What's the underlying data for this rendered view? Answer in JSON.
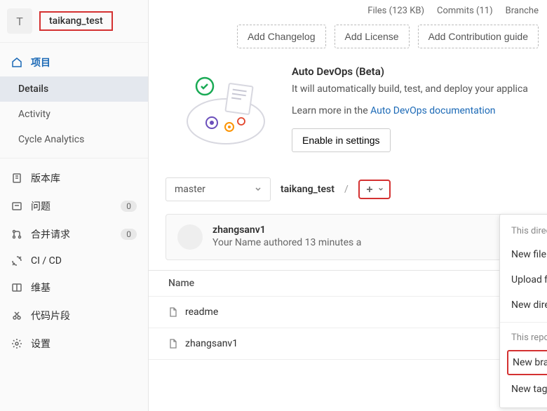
{
  "header": {
    "avatar_letter": "T",
    "project_name": "taikang_test"
  },
  "sidebar": {
    "project_label": "项目",
    "items": [
      {
        "label": "Details"
      },
      {
        "label": "Activity"
      },
      {
        "label": "Cycle Analytics"
      }
    ],
    "nav": [
      {
        "label": "版本库",
        "icon": "repo"
      },
      {
        "label": "问题",
        "icon": "issues",
        "badge": "0"
      },
      {
        "label": "合并请求",
        "icon": "merge",
        "badge": "0"
      },
      {
        "label": "CI / CD",
        "icon": "cicd"
      },
      {
        "label": "维基",
        "icon": "wiki"
      },
      {
        "label": "代码片段",
        "icon": "snippets"
      },
      {
        "label": "设置",
        "icon": "settings"
      }
    ]
  },
  "top_stats": {
    "files": "Files (123 KB)",
    "commits": "Commits (11)",
    "branches": "Branche"
  },
  "quick_actions": {
    "changelog": "Add Changelog",
    "license": "Add License",
    "contribution": "Add Contribution guide"
  },
  "devops": {
    "title": "Auto DevOps (Beta)",
    "description": "It will automatically build, test, and deploy your applica",
    "learn_prefix": "Learn more in the ",
    "learn_link": "Auto DevOps documentation",
    "enable_btn": "Enable in settings"
  },
  "branch": {
    "selected": "master",
    "breadcrumb": "taikang_test",
    "sep": "/"
  },
  "commit": {
    "author": "zhangsanv1",
    "meta": "Your Name authored 13 minutes a"
  },
  "files": {
    "header_name": "Name",
    "rows": [
      {
        "name": "readme"
      },
      {
        "name": "zhangsanv1"
      }
    ]
  },
  "dropdown": {
    "section1": "This directory",
    "items1": [
      {
        "label": "New file"
      },
      {
        "label": "Upload file"
      },
      {
        "label": "New directory"
      }
    ],
    "section2": "This repository",
    "items2": [
      {
        "label": "New branch",
        "highlighted": true
      },
      {
        "label": "New tag"
      }
    ]
  }
}
